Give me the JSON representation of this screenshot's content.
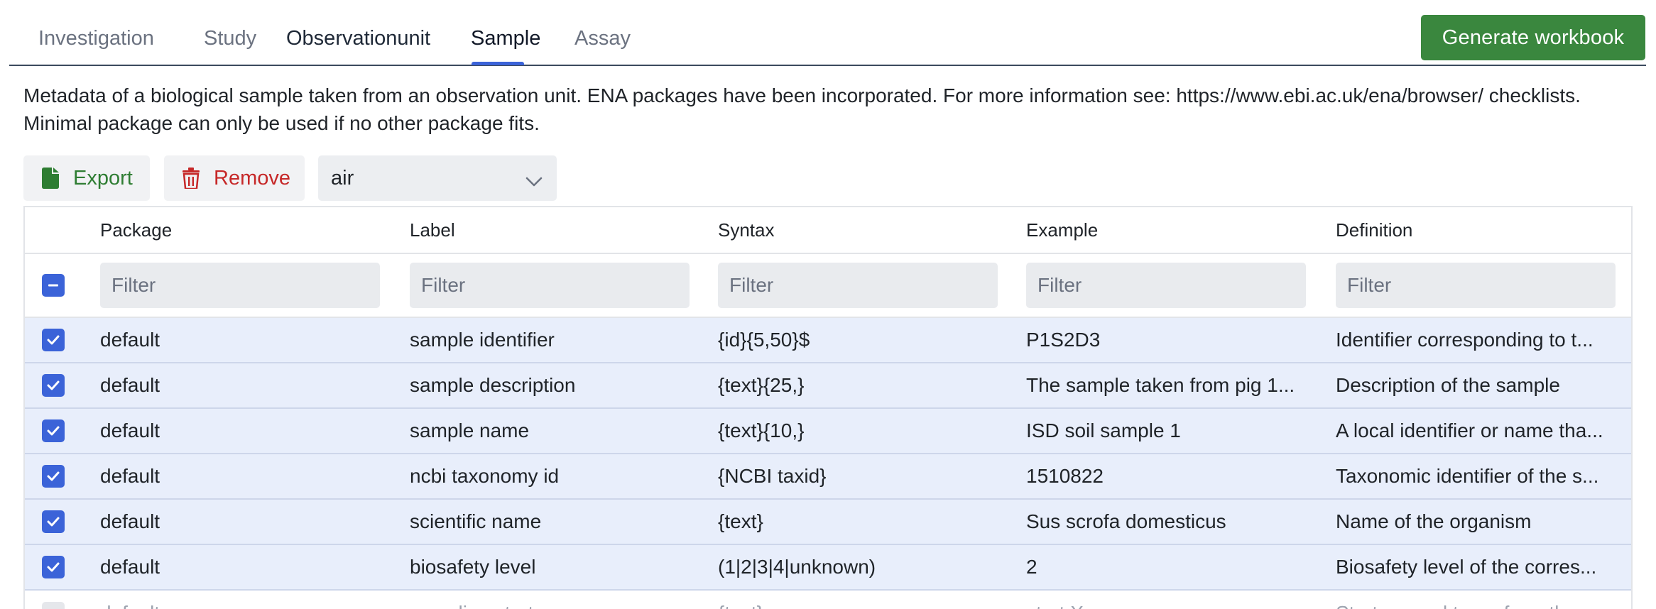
{
  "tabs": {
    "items": [
      {
        "label": "Investigation"
      },
      {
        "label": "Study"
      },
      {
        "label": "Observationunit"
      },
      {
        "label": "Sample"
      },
      {
        "label": "Assay"
      }
    ],
    "active": "Sample"
  },
  "header": {
    "generate_label": "Generate workbook"
  },
  "description": "Metadata of a biological sample taken from an observation unit. ENA packages have been incorporated. For more information see: https://www.ebi.ac.uk/ena/browser/ checklists. Minimal package can only be used if no other package fits.",
  "toolbar": {
    "export_label": "Export",
    "remove_label": "Remove",
    "package_select_value": "air"
  },
  "table": {
    "columns": [
      "Package",
      "Label",
      "Syntax",
      "Example",
      "Definition"
    ],
    "filter_placeholder": "Filter",
    "rows": [
      {
        "package": "default",
        "label": "sample identifier",
        "syntax": "{id}{5,50}$",
        "example": "P1S2D3",
        "definition": "Identifier corresponding to t..."
      },
      {
        "package": "default",
        "label": "sample description",
        "syntax": "{text}{25,}",
        "example": "The sample taken from pig 1...",
        "definition": "Description of the sample"
      },
      {
        "package": "default",
        "label": "sample name",
        "syntax": "{text}{10,}",
        "example": "ISD soil sample 1",
        "definition": "A local identifier or name tha..."
      },
      {
        "package": "default",
        "label": "ncbi taxonomy id",
        "syntax": "{NCBI taxid}",
        "example": "1510822",
        "definition": "Taxonomic identifier of the s..."
      },
      {
        "package": "default",
        "label": "scientific name",
        "syntax": "{text}",
        "example": "Sus scrofa domesticus",
        "definition": "Name of the organism"
      },
      {
        "package": "default",
        "label": "biosafety level",
        "syntax": "(1|2|3|4|unknown)",
        "example": "2",
        "definition": "Biosafety level of the corres..."
      },
      {
        "package": "default",
        "label": "sampling strat",
        "syntax": "{text}",
        "example": "strat X",
        "definition": "Strat passed to perform the..."
      }
    ]
  },
  "colors": {
    "accent": "#3b63d8",
    "generate_button": "#3a873e",
    "export": "#2e7d32",
    "remove": "#c62828",
    "selected_row": "#e8eefb"
  },
  "icons": {
    "export": "file-icon",
    "remove": "trash-icon",
    "select": "chevron-down-icon"
  }
}
